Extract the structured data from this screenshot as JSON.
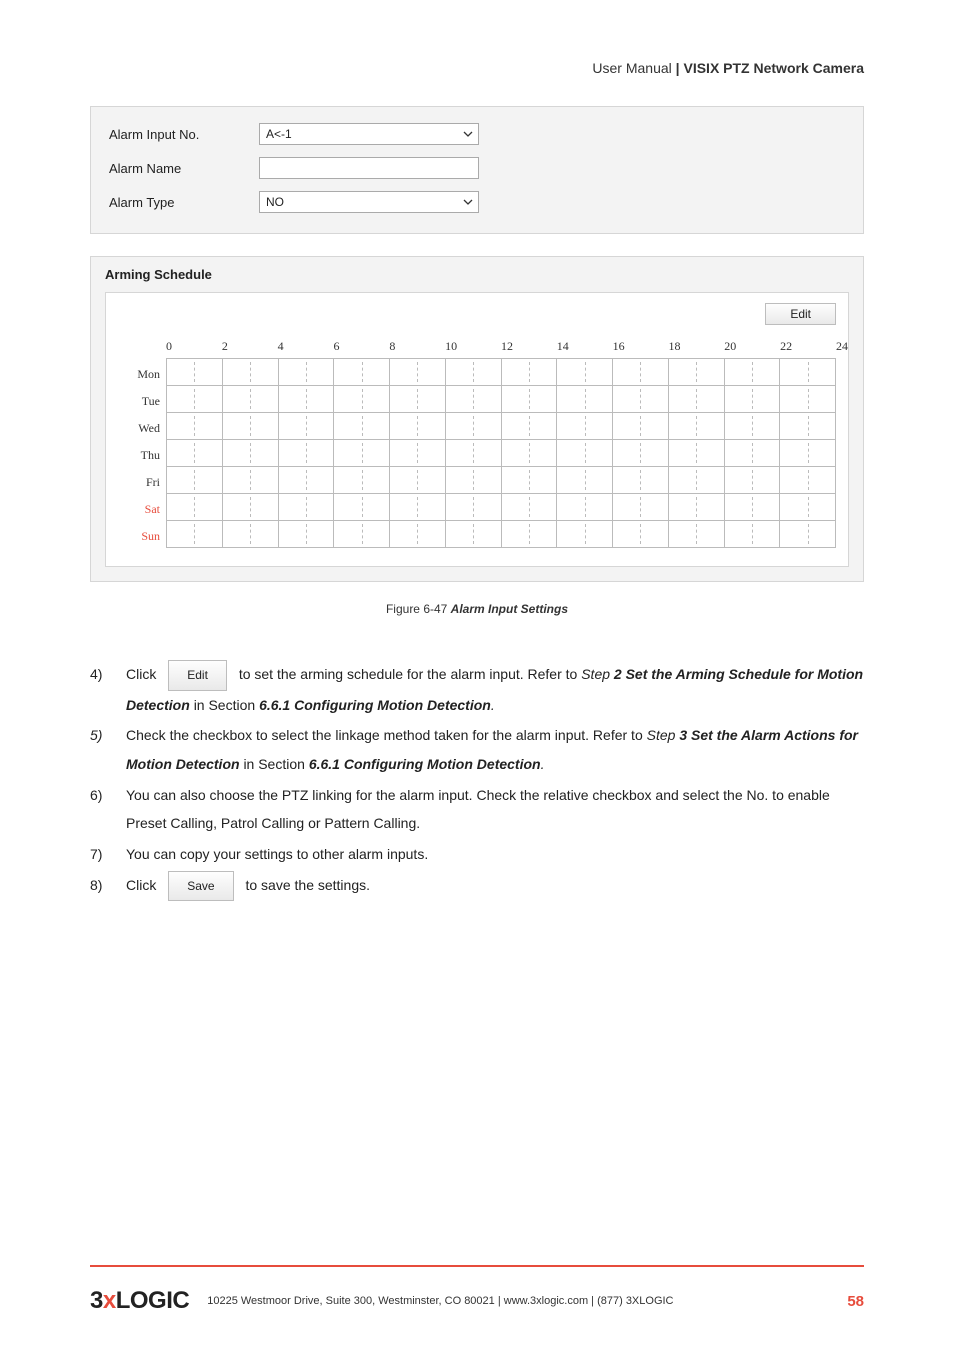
{
  "header": {
    "light": "User Manual ",
    "sep": "|",
    "bold": " VISIX PTZ Network Camera"
  },
  "alarm_config": {
    "input_no_label": "Alarm Input No.",
    "input_no_value": "A<-1",
    "name_label": "Alarm Name",
    "name_value": "",
    "type_label": "Alarm Type",
    "type_value": "NO"
  },
  "schedule": {
    "title": "Arming Schedule",
    "edit_label": "Edit",
    "hour_ticks": [
      "0",
      "2",
      "4",
      "6",
      "8",
      "10",
      "12",
      "14",
      "16",
      "18",
      "20",
      "22",
      "24"
    ],
    "days": [
      {
        "label": "Mon",
        "weekend": false
      },
      {
        "label": "Tue",
        "weekend": false
      },
      {
        "label": "Wed",
        "weekend": false
      },
      {
        "label": "Thu",
        "weekend": false
      },
      {
        "label": "Fri",
        "weekend": false
      },
      {
        "label": "Sat",
        "weekend": true
      },
      {
        "label": "Sun",
        "weekend": true
      }
    ]
  },
  "fig": {
    "label": "Figure 6-47 ",
    "title": "Alarm Input Settings"
  },
  "steps": {
    "s4": {
      "num": "4)",
      "pre": "Click ",
      "btn": "Edit",
      "post": " to set the arming schedule for the alarm input. Refer to ",
      "ref_it_pre": "Step ",
      "ref_bi": "2 Set the Arming Schedule for Motion Detection",
      "mid": " in Section ",
      "sec_bi": "6.6.1 Configuring Motion Detection",
      "tail": "."
    },
    "s5": {
      "num": "5)",
      "pre": "Check the checkbox to select the linkage method taken for the alarm input. Refer to ",
      "ref_it_pre": "Step ",
      "ref_bi": "3 Set the Alarm Actions for Motion Detection",
      "mid": " in Section ",
      "sec_bi": "6.6.1 Configuring Motion Detection",
      "tail": "."
    },
    "s6": {
      "num": "6)",
      "text": "You can also choose the PTZ linking for the alarm input. Check the relative checkbox and select the No. to enable Preset Calling, Patrol Calling or Pattern Calling."
    },
    "s7": {
      "num": "7)",
      "text": "You can copy your settings to other alarm inputs."
    },
    "s8": {
      "num": "8)",
      "pre": "Click ",
      "btn": "Save",
      "post": " to save the settings."
    }
  },
  "footer": {
    "logo_3": "3",
    "logo_x": "x",
    "logo_rest": "LOGIC",
    "text": "10225 Westmoor Drive, Suite 300, Westminster, CO 80021 | www.3xlogic.com | (877) 3XLOGIC",
    "page_no": "58"
  }
}
